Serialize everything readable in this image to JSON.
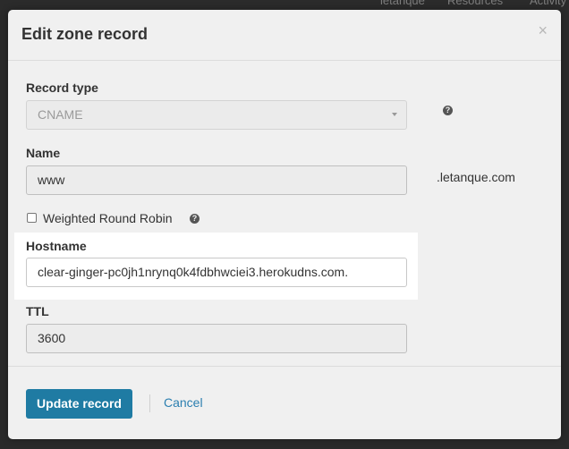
{
  "background": {
    "topbar_text_1": "letanque",
    "topbar_text_2": "Resources",
    "topbar_text_3": "Activity"
  },
  "modal": {
    "title": "Edit zone record",
    "close_glyph": "×"
  },
  "form": {
    "record_type": {
      "label": "Record type",
      "value": "CNAME",
      "help_glyph": "?"
    },
    "name": {
      "label": "Name",
      "value": "www",
      "suffix": ".letanque.com"
    },
    "weighted_round_robin": {
      "label": "Weighted Round Robin",
      "checked": false,
      "help_glyph": "?"
    },
    "hostname": {
      "label": "Hostname",
      "value": "clear-ginger-pc0jh1nrynq0k4fdbhwciei3.herokudns.com."
    },
    "ttl": {
      "label": "TTL",
      "value": "3600"
    }
  },
  "footer": {
    "update_label": "Update record",
    "cancel_label": "Cancel"
  },
  "colors": {
    "primary": "#1f7ba3",
    "link": "#2b7fb0",
    "modal_bg": "#f0f0f0",
    "highlight": "#ffffff"
  }
}
